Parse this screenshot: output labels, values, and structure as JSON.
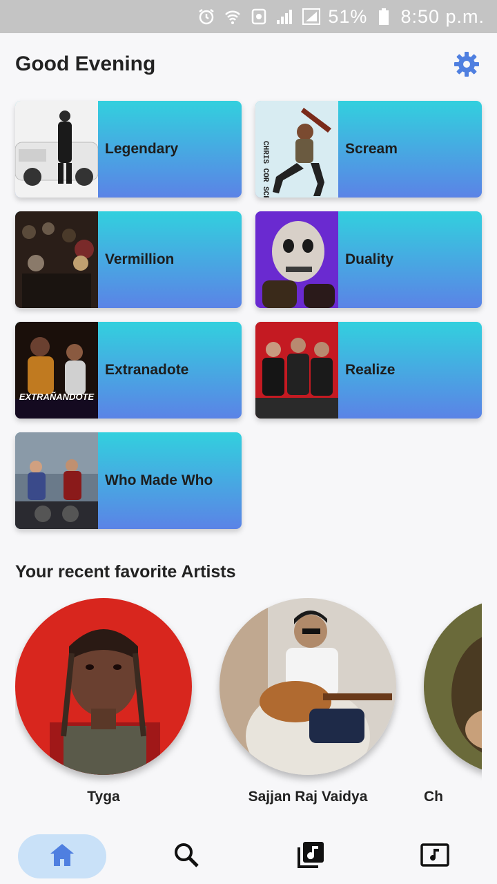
{
  "status_bar": {
    "battery": "51%",
    "time": "8:50 p.m."
  },
  "header": {
    "greeting": "Good Evening"
  },
  "albums": [
    {
      "title": "Legendary"
    },
    {
      "title": "Scream",
      "cover_text": "CHRIS COR SCREAM"
    },
    {
      "title": "Vermillion"
    },
    {
      "title": "Duality"
    },
    {
      "title": "Extranadote",
      "cover_text": "EXTRAÑANDOTE"
    },
    {
      "title": "Realize"
    },
    {
      "title": "Who Made Who"
    }
  ],
  "artists_section": {
    "title": "Your recent favorite Artists",
    "artists": [
      {
        "name": "Tyga"
      },
      {
        "name": "Sajjan Raj Vaidya"
      },
      {
        "name": "Ch"
      }
    ]
  },
  "nav": {
    "items": [
      "home-icon",
      "search-icon",
      "library-icon",
      "now-playing-icon"
    ],
    "active": "home-icon"
  },
  "colors": {
    "accent": "#4f7fe0",
    "card_top": "#32d0de",
    "card_bottom": "#5b83e6",
    "nav_active_bg": "#c9e1f8"
  }
}
